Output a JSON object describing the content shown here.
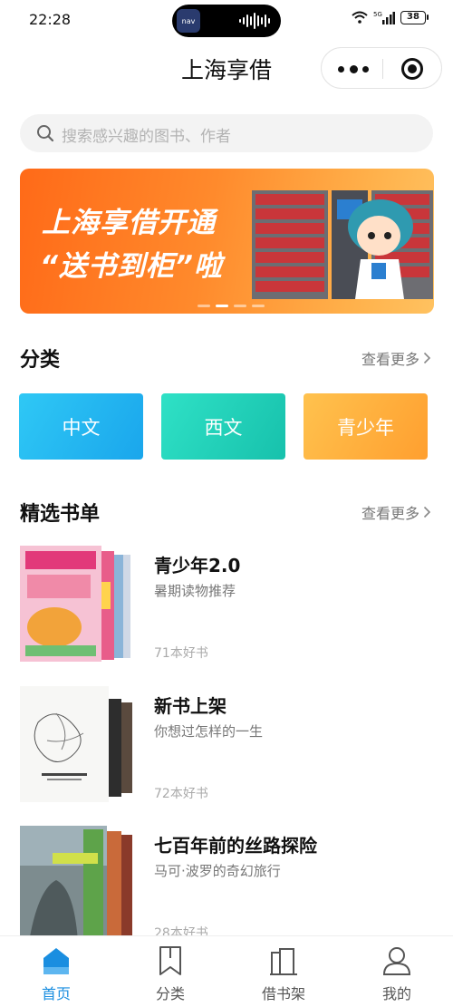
{
  "status": {
    "time": "22:28",
    "battery": "38",
    "network": "5G"
  },
  "island": {
    "app_label": "nav"
  },
  "header": {
    "title": "上海享借"
  },
  "search": {
    "placeholder": "搜索感兴趣的图书、作者"
  },
  "banner": {
    "line1": "上海享借开通",
    "line2": "“送书到柜”啦"
  },
  "categories": {
    "title": "分类",
    "more": "查看更多",
    "items": [
      {
        "label": "中文",
        "color": "#1aa6ec"
      },
      {
        "label": "西文",
        "color": "#17c1ac"
      },
      {
        "label": "青少年",
        "color": "#ff9f2f"
      }
    ]
  },
  "booklists": {
    "title": "精选书单",
    "more": "查看更多",
    "items": [
      {
        "title": "青少年2.0",
        "subtitle": "暑期读物推荐",
        "count": "71本好书"
      },
      {
        "title": "新书上架",
        "subtitle": "你想过怎样的一生",
        "count": "72本好书"
      },
      {
        "title": "七百年前的丝路探险",
        "subtitle": "马可·波罗的奇幻旅行",
        "count": "28本好书"
      }
    ]
  },
  "tabbar": {
    "active_color": "#1a8ee0",
    "items": [
      {
        "label": "首页",
        "icon": "home-icon"
      },
      {
        "label": "分类",
        "icon": "bookmark-icon"
      },
      {
        "label": "借书架",
        "icon": "bookshelf-icon"
      },
      {
        "label": "我的",
        "icon": "user-icon"
      }
    ]
  }
}
